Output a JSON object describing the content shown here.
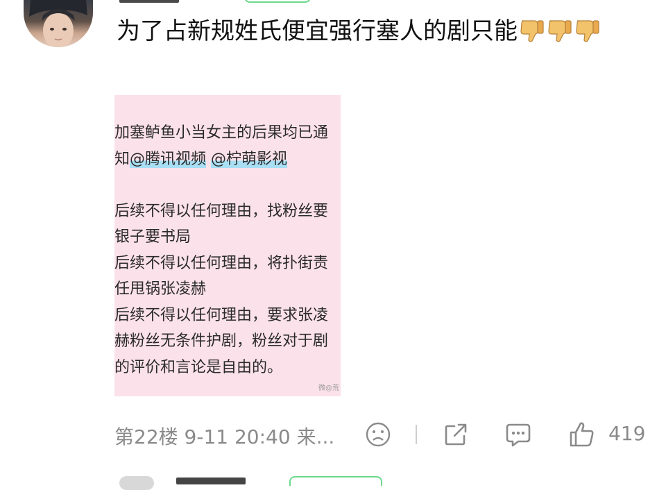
{
  "comment": {
    "text": "为了占新规姓氏便宜强行塞人的剧只能",
    "thumbs_down_count": 3,
    "image": {
      "lines": [
        "加塞鲈鱼小当女主的后果均已通",
        "知",
        "@腾讯视频",
        " ",
        "@柠萌影视",
        "",
        "后续不得以任何理由，找粉丝要",
        "银子要书局",
        "后续不得以任何理由，将扑街责",
        "任甩锅张凌赫",
        "后续不得以任何理由，要求张凌",
        "赫粉丝无条件护剧，粉丝对于剧",
        "的评价和言论是自由的。"
      ],
      "watermark": "微@荒"
    },
    "footer": {
      "meta": "第22楼  9-11 20:40  来...",
      "like_count": "419"
    }
  },
  "icons": {
    "emoji": "thumbs-down-emoji",
    "sad": "sad-face-icon",
    "share": "share-icon",
    "comment": "comment-icon",
    "like": "thumbs-up-icon"
  },
  "colors": {
    "image_bg": "#fbe1ea",
    "mention_highlight": "#a9dff4",
    "meta_gray": "#8a8a8a",
    "badge_green": "#6cd98b"
  }
}
